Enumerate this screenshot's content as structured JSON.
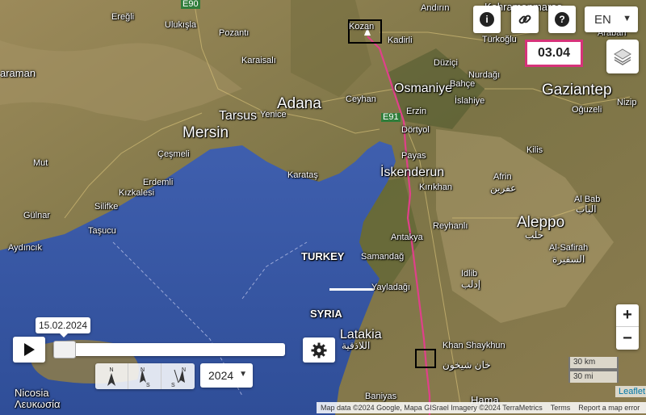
{
  "labels": {
    "kahramanmaras": "Kahramanmaras",
    "eregli": "Ereğli",
    "ulukisla": "Ulukışla",
    "pozanti": "Pozantı",
    "karaisali": "Karaisalı",
    "kozan": "Kozan",
    "kadirli": "Kadirli",
    "andirin": "Andırın",
    "duzici": "Düziçi",
    "turkoglu": "Türkoğlu",
    "arabah": "Arabah",
    "osmaniye": "Osmaniye",
    "bahce": "Bahçe",
    "nurdagi": "Nurdağı",
    "gaziantep": "Gaziantep",
    "oguzeli": "Oğuzeli",
    "nizip": "Nizip",
    "aramanlar": "araman",
    "adana": "Adana",
    "ceyhan": "Ceyhan",
    "erzin": "Erzin",
    "islahiye": "İslahiye",
    "tarsus": "Tarsus",
    "yenice": "Yenice",
    "dortyol": "Dörtyol",
    "mersin": "Mersin",
    "cesmeli": "Çeşmeli",
    "payas": "Payas",
    "kilis": "Kilis",
    "mut": "Mut",
    "erdemli": "Erdemli",
    "karatas": "Karataş",
    "iskenderun": "İskenderun",
    "afrin": "Afrin",
    "afrin_ar": "عفرين",
    "kirikhan": "Kırıkhan",
    "kizkalesi": "Kızkalesi",
    "silifke": "Silifke",
    "gulnar": "Gülnar",
    "tasucu": "Taşucu",
    "al_bab": "Al Bab",
    "al_bab_ar": "الباب",
    "reyhanli": "Reyhanlı",
    "aleppo": "Aleppo",
    "aleppo_ar": "حلب",
    "aydincik": "Aydıncık",
    "antakya": "Antakya",
    "al_safirah": "Al-Safirah",
    "al_safirah_ar": "السفيرة",
    "turkey": "TURKEY",
    "samandag": "Samandağ",
    "idlib": "Idlib",
    "idlib_ar": "إدلب",
    "yayladagi": "Yayladağı",
    "syria": "SYRIA",
    "latakia": "Latakia",
    "latakia_ar": "اللاذقية",
    "khan_shaykhun": "Khan Shaykhun",
    "khan_shaykhun_ar": "خان شيخون",
    "nicosia": "Nicosia",
    "lefkosia": "Λευκωσία",
    "baniyas": "Baniyas",
    "hama": "Hama",
    "e90": "E90",
    "e91": "E91"
  },
  "controls": {
    "info_icon": "i",
    "help_icon": "?",
    "language": "EN",
    "date_display": "03.04",
    "zoom_in": "+",
    "zoom_out": "−",
    "scale_km": "30 km",
    "scale_mi": "30 mi",
    "leaflet": "Leaflet"
  },
  "timeline": {
    "date_tooltip": "15.02.2024",
    "year": "2024",
    "progress": 0.0,
    "compass_n1": "N",
    "compass_n2": "N",
    "compass_s2": "S",
    "compass_n3": "N",
    "compass_s3": "S"
  },
  "attribution": {
    "map_data": "Map data ©2024 Google, Mapa GISrael Imagery ©2024 TerraMetrics",
    "terms": "Terms",
    "report": "Report a map error"
  },
  "colors": {
    "route": "#e0408a",
    "date_border": "#d6337a",
    "sea": "#3e5ea8",
    "land": "#8a7a4e"
  }
}
